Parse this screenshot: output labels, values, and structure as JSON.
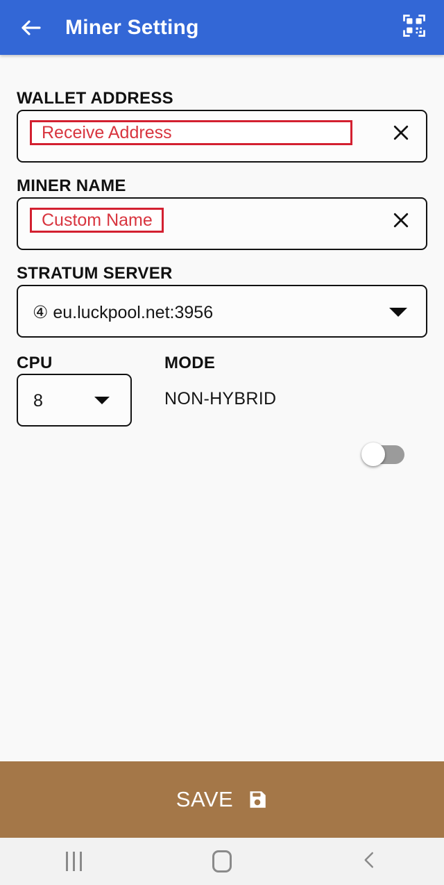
{
  "appbar": {
    "back_icon": "arrow-left-icon",
    "title": "Miner Setting",
    "qr_icon": "qr-code-scan-icon",
    "background_color": "#3367d6"
  },
  "form": {
    "wallet": {
      "label": "WALLET ADDRESS",
      "placeholder": "Receive Address",
      "value": "",
      "highlight_color": "#d32030",
      "clear_icon": "close-x-icon"
    },
    "miner_name": {
      "label": "MINER NAME",
      "placeholder": "Custom Name",
      "value": "",
      "highlight_color": "#d32030",
      "clear_icon": "close-x-icon"
    },
    "stratum_server": {
      "label": "STRATUM SERVER",
      "selected": "④ eu.luckpool.net:3956",
      "dropdown_icon": "chevron-down-icon"
    },
    "cpu": {
      "label": "CPU",
      "selected": "8",
      "dropdown_icon": "chevron-down-icon"
    },
    "mode": {
      "label": "MODE",
      "value": "NON-HYBRID",
      "toggle_on": false
    }
  },
  "save_bar": {
    "label": "SAVE",
    "icon": "floppy-disk-save-icon",
    "background_color": "#a47748"
  },
  "navbar": {
    "recents_icon": "recents-icon",
    "home_icon": "home-icon",
    "back_icon": "back-chevron-icon"
  }
}
